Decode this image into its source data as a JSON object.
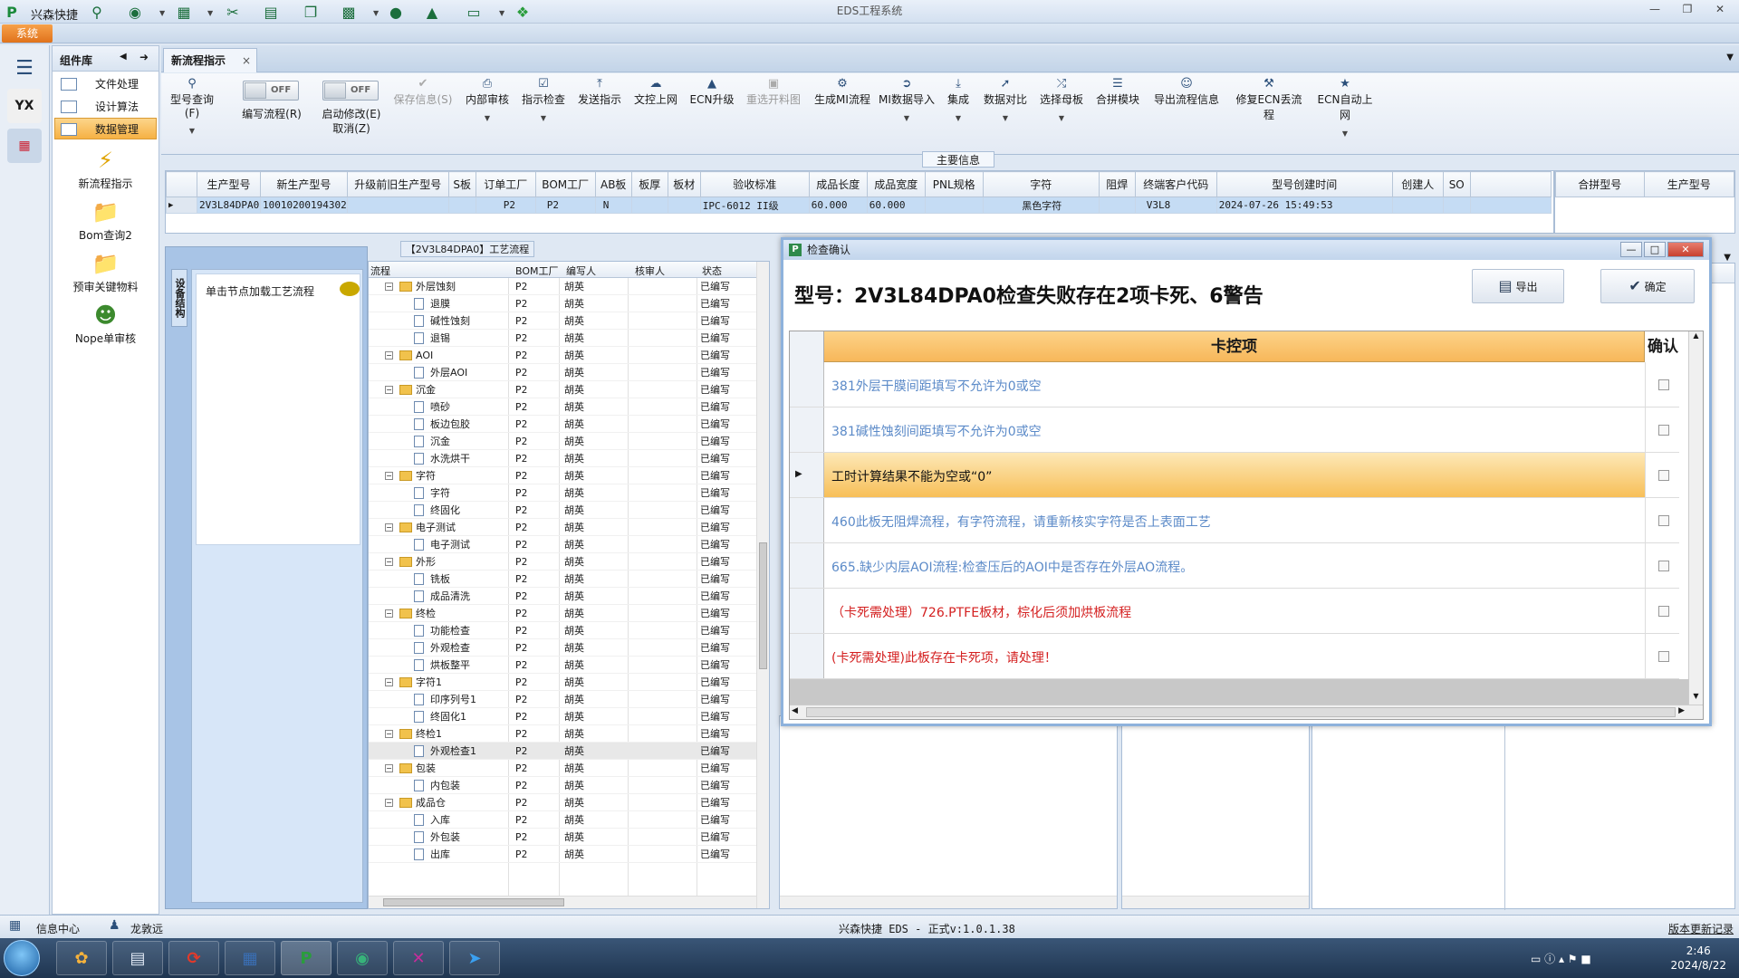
{
  "titlebar": {
    "app_name": "兴森快捷",
    "window_title": "EDS工程系统"
  },
  "sysmenu": {
    "system_tab": "系统"
  },
  "component_lib": {
    "title": "组件库",
    "items": [
      "文件处理",
      "设计算法",
      "数据管理"
    ],
    "active_item": "数据管理",
    "big_items": [
      "新流程指示",
      "Bom查询2",
      "预审关键物料",
      "Nope单审核"
    ]
  },
  "tab": {
    "label": "新流程指示",
    "close": "×"
  },
  "ribbon": {
    "buttons": [
      {
        "label": "型号查询(F)",
        "icon": "search-icon"
      },
      {
        "label": "保存信息(S)",
        "icon": "check-icon",
        "disabled": true
      },
      {
        "label": "内部审核",
        "icon": "print-icon"
      },
      {
        "label": "指示检查",
        "icon": "checklist-icon"
      },
      {
        "label": "发送指示",
        "icon": "upload-icon"
      },
      {
        "label": "文控上网",
        "icon": "cloud-upload-icon"
      },
      {
        "label": "ECN升级",
        "icon": "ecn-icon"
      },
      {
        "label": "重选开料图",
        "icon": "image-icon",
        "disabled": true
      },
      {
        "label": "生成MI流程",
        "icon": "flow-icon"
      },
      {
        "label": "MI数据导入",
        "icon": "import-icon"
      },
      {
        "label": "集成",
        "icon": "merge-icon"
      },
      {
        "label": "数据对比",
        "icon": "compare-icon"
      },
      {
        "label": "选择母板",
        "icon": "shuffle-icon"
      },
      {
        "label": "合拼模块",
        "icon": "list-icon"
      },
      {
        "label": "导出流程信息",
        "icon": "export-icon"
      },
      {
        "label": "修复ECN丢流程",
        "icon": "wrench-icon"
      },
      {
        "label": "ECN自动上网",
        "icon": "star-icon"
      }
    ],
    "toggle1": {
      "state": "OFF",
      "label": "编写流程(R)"
    },
    "toggle2": {
      "state": "OFF",
      "label": "启动修改(E)",
      "sub_label": "取消(Z)"
    }
  },
  "main_info": {
    "title": "主要信息",
    "columns": [
      "生产型号",
      "新生产型号",
      "升级前旧生产型号",
      "S板",
      "订单工厂",
      "BOM工厂",
      "AB板",
      "板厚",
      "板材",
      "验收标准",
      "成品长度",
      "成品宽度",
      "PNL规格",
      "字符",
      "阻焊",
      "终端客户代码",
      "型号创建时间",
      "创建人",
      "SO"
    ],
    "row": [
      "2V3L84DPA0",
      "10010200194302",
      "",
      "",
      "P2",
      "P2",
      "N",
      "",
      "",
      "IPC-6012 II级",
      "60.000",
      "60.000",
      "",
      "黑色字符",
      "",
      "V3L8",
      "2024-07-26 15:49:53",
      "",
      ""
    ],
    "side_columns": [
      "合拼型号",
      "生产型号"
    ]
  },
  "nav_pane": {
    "vertical_tab": "设备结构",
    "prompt": "单击节点加载工艺流程"
  },
  "tree": {
    "title": "【2V3L84DPA0】工艺流程",
    "columns": [
      "流程",
      "BOM工厂",
      "编写人",
      "核审人",
      "状态"
    ],
    "rows": [
      {
        "name": "外层蚀刻",
        "level": 0,
        "factory": "P2",
        "writer": "胡英",
        "status": "已编写"
      },
      {
        "name": "退膜",
        "level": 1,
        "factory": "P2",
        "writer": "胡英",
        "status": "已编写"
      },
      {
        "name": "碱性蚀刻",
        "level": 1,
        "factory": "P2",
        "writer": "胡英",
        "status": "已编写"
      },
      {
        "name": "退锡",
        "level": 1,
        "factory": "P2",
        "writer": "胡英",
        "status": "已编写"
      },
      {
        "name": "AOI",
        "level": 0,
        "factory": "P2",
        "writer": "胡英",
        "status": "已编写"
      },
      {
        "name": "外层AOI",
        "level": 1,
        "factory": "P2",
        "writer": "胡英",
        "status": "已编写"
      },
      {
        "name": "沉金",
        "level": 0,
        "factory": "P2",
        "writer": "胡英",
        "status": "已编写"
      },
      {
        "name": "喷砂",
        "level": 1,
        "factory": "P2",
        "writer": "胡英",
        "status": "已编写"
      },
      {
        "name": "板边包胶",
        "level": 1,
        "factory": "P2",
        "writer": "胡英",
        "status": "已编写"
      },
      {
        "name": "沉金",
        "level": 1,
        "factory": "P2",
        "writer": "胡英",
        "status": "已编写"
      },
      {
        "name": "水洗烘干",
        "level": 1,
        "factory": "P2",
        "writer": "胡英",
        "status": "已编写"
      },
      {
        "name": "字符",
        "level": 0,
        "factory": "P2",
        "writer": "胡英",
        "status": "已编写"
      },
      {
        "name": "字符",
        "level": 1,
        "factory": "P2",
        "writer": "胡英",
        "status": "已编写"
      },
      {
        "name": "终固化",
        "level": 1,
        "factory": "P2",
        "writer": "胡英",
        "status": "已编写"
      },
      {
        "name": "电子测试",
        "level": 0,
        "factory": "P2",
        "writer": "胡英",
        "status": "已编写"
      },
      {
        "name": "电子测试",
        "level": 1,
        "factory": "P2",
        "writer": "胡英",
        "status": "已编写"
      },
      {
        "name": "外形",
        "level": 0,
        "factory": "P2",
        "writer": "胡英",
        "status": "已编写"
      },
      {
        "name": "铣板",
        "level": 1,
        "factory": "P2",
        "writer": "胡英",
        "status": "已编写"
      },
      {
        "name": "成品清洗",
        "level": 1,
        "factory": "P2",
        "writer": "胡英",
        "status": "已编写"
      },
      {
        "name": "终检",
        "level": 0,
        "factory": "P2",
        "writer": "胡英",
        "status": "已编写"
      },
      {
        "name": "功能检查",
        "level": 1,
        "factory": "P2",
        "writer": "胡英",
        "status": "已编写"
      },
      {
        "name": "外观检查",
        "level": 1,
        "factory": "P2",
        "writer": "胡英",
        "status": "已编写"
      },
      {
        "name": "烘板整平",
        "level": 1,
        "factory": "P2",
        "writer": "胡英",
        "status": "已编写"
      },
      {
        "name": "字符1",
        "level": 0,
        "factory": "P2",
        "writer": "胡英",
        "status": "已编写"
      },
      {
        "name": "印序列号1",
        "level": 1,
        "factory": "P2",
        "writer": "胡英",
        "status": "已编写"
      },
      {
        "name": "终固化1",
        "level": 1,
        "factory": "P2",
        "writer": "胡英",
        "status": "已编写"
      },
      {
        "name": "终检1",
        "level": 0,
        "factory": "P2",
        "writer": "胡英",
        "status": "已编写"
      },
      {
        "name": "外观检查1",
        "level": 1,
        "factory": "P2",
        "writer": "胡英",
        "status": "已编写",
        "selected": true
      },
      {
        "name": "包装",
        "level": 0,
        "factory": "P2",
        "writer": "胡英",
        "status": "已编写"
      },
      {
        "name": "内包装",
        "level": 1,
        "factory": "P2",
        "writer": "胡英",
        "status": "已编写"
      },
      {
        "name": "成品仓",
        "level": 0,
        "factory": "P2",
        "writer": "胡英",
        "status": "已编写"
      },
      {
        "name": "入库",
        "level": 1,
        "factory": "P2",
        "writer": "胡英",
        "status": "已编写"
      },
      {
        "name": "外包装",
        "level": 1,
        "factory": "P2",
        "writer": "胡英",
        "status": "已编写"
      },
      {
        "name": "出库",
        "level": 1,
        "factory": "P2",
        "writer": "胡英",
        "status": "已编写"
      }
    ]
  },
  "dialog": {
    "title": "检查确认",
    "heading": "型号：2V3L84DPA0检查失败存在2项卡死、6警告",
    "export_label": "导出",
    "confirm_label": "确定",
    "col_item": "卡控项",
    "col_confirm": "确认",
    "rows": [
      {
        "text": "381外层干膜间距填写不允许为0或空",
        "kind": "warn"
      },
      {
        "text": "381碱性蚀刻间距填写不允许为0或空",
        "kind": "warn"
      },
      {
        "text": "工时计算结果不能为空或“0”",
        "kind": "cur"
      },
      {
        "text": "460此板无阻焊流程，有字符流程，请重新核实字符是否上表面工艺",
        "kind": "warn"
      },
      {
        "text": "665.缺少内层AOI流程:检查压后的AOI中是否存在外层AO流程。",
        "kind": "warn"
      },
      {
        "text": "（卡死需处理）726.PTFE板材，棕化后须加烘板流程",
        "kind": "err"
      },
      {
        "text": "(卡死需处理)此板存在卡死项，请处理！",
        "kind": "err"
      }
    ]
  },
  "status": {
    "info_center": "信息中心",
    "user": "龙敦远",
    "center_text": "兴森快捷 EDS - 正式v:1.0.1.38",
    "right_link": "版本更新记录"
  },
  "taskbar": {
    "time": "2:46",
    "date": "2024/8/22"
  }
}
